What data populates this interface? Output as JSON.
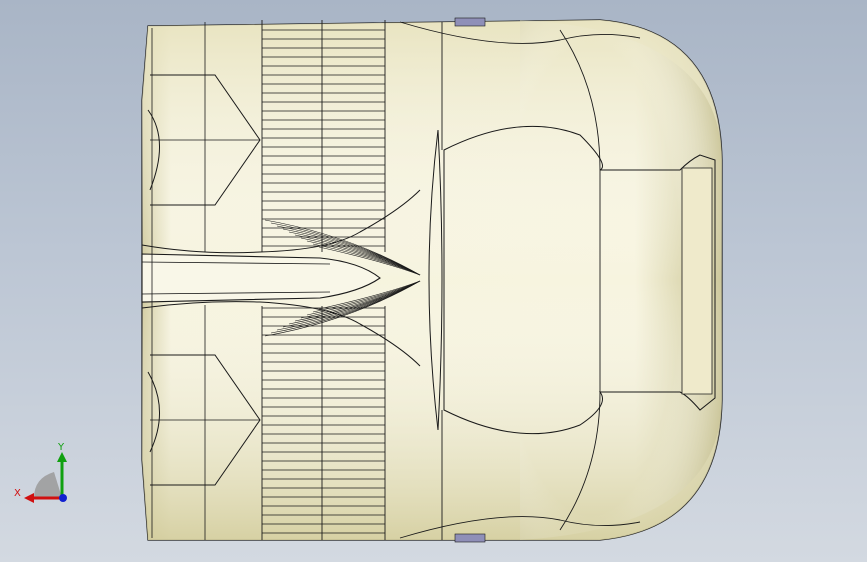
{
  "viewport": {
    "background_top": "#a9b5c6",
    "background_bottom": "#d3d9e1"
  },
  "model": {
    "body_color": "#f4f1da",
    "shade_color": "#d9d4a6",
    "edge_color": "#1a1a1a",
    "hint_color": "#8f8fb8"
  },
  "triad": {
    "x_label": "X",
    "y_label": "Y",
    "x_color": "#d01010",
    "y_color": "#10a010",
    "z_color": "#1020d0",
    "plane_color": "#9a9a9a"
  }
}
